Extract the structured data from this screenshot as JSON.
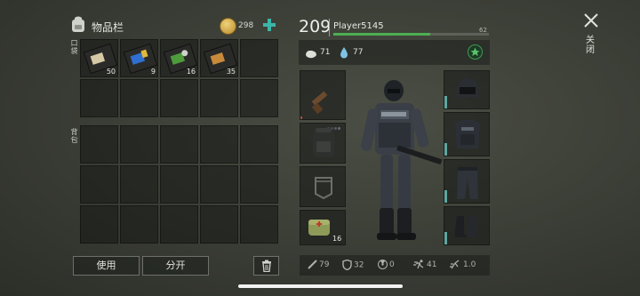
{
  "inventory": {
    "title": "物品栏",
    "currency_value": "298",
    "pocket_label": "口袋",
    "backpack_label": "背包",
    "pocket_items": [
      {
        "name": "bandit-map-icon",
        "count": "50"
      },
      {
        "name": "police-badge-map-icon",
        "count": "9"
      },
      {
        "name": "green-badge-map-icon",
        "count": "16"
      },
      {
        "name": "orange-map-icon",
        "count": "35"
      },
      {
        "name": "",
        "count": ""
      }
    ],
    "use_label": "使用",
    "split_label": "分开"
  },
  "player": {
    "level": "209",
    "name": "Player5145",
    "xp_value": "62",
    "xp_fraction": 0.62,
    "food": "71",
    "water": "77"
  },
  "equipment": {
    "medkit_count": "16"
  },
  "stats": {
    "attack": "79",
    "armor": "32",
    "radiation": "0",
    "speed": "41",
    "stealth": "1.0"
  },
  "close_label": "关闭",
  "colors": {
    "accent_teal": "#5fa6a0",
    "xp_green": "#4caf50",
    "plus_teal": "#3bb6a8"
  }
}
